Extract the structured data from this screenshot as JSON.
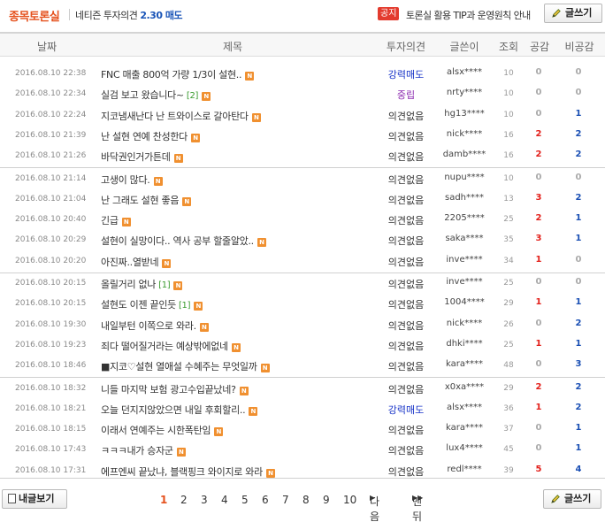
{
  "header": {
    "title_part1": "종목",
    "title_part2": "토론실",
    "stock_name": "네티즌 투자의견",
    "opinion_score": "2.30 매도",
    "notice_badge": "공지",
    "notice_text": "토론실 활용 TIP과 운영원칙 안내",
    "write_label": "글쓰기"
  },
  "columns": [
    "날짜",
    "제목",
    "투자의견",
    "글쓴이",
    "조회",
    "공감",
    "비공감"
  ],
  "rows": [
    {
      "date": "2016.08.10 22:38",
      "title": "FNC 매출 800억 가량 1/3이 설현..",
      "comments": "",
      "opinion": "강력매도",
      "author": "alsx****",
      "views": "10",
      "likes": "0",
      "dislikes": "0"
    },
    {
      "date": "2016.08.10 22:34",
      "title": "실검 보고 왔습니다~",
      "comments": "[2]",
      "opinion": "중립",
      "author": "nrty****",
      "views": "10",
      "likes": "0",
      "dislikes": "0"
    },
    {
      "date": "2016.08.10 22:24",
      "title": "지코냄새난다 난 트와이스로 갈아탄다",
      "comments": "",
      "opinion": "의견없음",
      "author": "hg13****",
      "views": "10",
      "likes": "0",
      "dislikes": "1"
    },
    {
      "date": "2016.08.10 21:39",
      "title": "난 설현 연예 찬성한다",
      "comments": "",
      "opinion": "의견없음",
      "author": "nick****",
      "views": "16",
      "likes": "2",
      "dislikes": "2"
    },
    {
      "date": "2016.08.10 21:26",
      "title": "바닥권인거가튼데",
      "comments": "",
      "opinion": "의견없음",
      "author": "damb****",
      "views": "16",
      "likes": "2",
      "dislikes": "2"
    },
    {
      "date": "2016.08.10 21:14",
      "title": "고생이 많다.",
      "comments": "",
      "opinion": "의견없음",
      "author": "nupu****",
      "views": "10",
      "likes": "0",
      "dislikes": "0"
    },
    {
      "date": "2016.08.10 21:04",
      "title": "난 그래도 설현 좋음",
      "comments": "",
      "opinion": "의견없음",
      "author": "sadh****",
      "views": "13",
      "likes": "3",
      "dislikes": "2"
    },
    {
      "date": "2016.08.10 20:40",
      "title": "긴급",
      "comments": "",
      "opinion": "의견없음",
      "author": "2205****",
      "views": "25",
      "likes": "2",
      "dislikes": "1"
    },
    {
      "date": "2016.08.10 20:29",
      "title": "설현이 실망이다.. 역사 공부 할줄알았..",
      "comments": "",
      "opinion": "의견없음",
      "author": "saka****",
      "views": "35",
      "likes": "3",
      "dislikes": "1"
    },
    {
      "date": "2016.08.10 20:20",
      "title": "아진짜..열받네",
      "comments": "",
      "opinion": "의견없음",
      "author": "inve****",
      "views": "34",
      "likes": "1",
      "dislikes": "0"
    },
    {
      "date": "2016.08.10 20:15",
      "title": "올릴거리 없나",
      "comments": "[1]",
      "opinion": "의견없음",
      "author": "inve****",
      "views": "25",
      "likes": "0",
      "dislikes": "0"
    },
    {
      "date": "2016.08.10 20:15",
      "title": "설현도 이젠 끝인듯",
      "comments": "[1]",
      "opinion": "의견없음",
      "author": "1004****",
      "views": "29",
      "likes": "1",
      "dislikes": "1"
    },
    {
      "date": "2016.08.10 19:30",
      "title": "내일부턴 이쪽으로 와라.",
      "comments": "",
      "opinion": "의견없음",
      "author": "nick****",
      "views": "26",
      "likes": "0",
      "dislikes": "2"
    },
    {
      "date": "2016.08.10 19:23",
      "title": "죄다 떨어질거라는 예상밖에없네",
      "comments": "",
      "opinion": "의견없음",
      "author": "dhki****",
      "views": "25",
      "likes": "1",
      "dislikes": "1"
    },
    {
      "date": "2016.08.10 18:46",
      "title": "■지코♡설현 열애설 수혜주는 무엇일까",
      "comments": "",
      "opinion": "의견없음",
      "author": "kara****",
      "views": "48",
      "likes": "0",
      "dislikes": "3"
    },
    {
      "date": "2016.08.10 18:32",
      "title": "니들 마지막 보험 광고수입끝났네?",
      "comments": "",
      "opinion": "의견없음",
      "author": "x0xa****",
      "views": "29",
      "likes": "2",
      "dislikes": "2"
    },
    {
      "date": "2016.08.10 18:21",
      "title": "오늘 던지지않았으면 내일 후회할리..",
      "comments": "",
      "opinion": "강력매도",
      "author": "alsx****",
      "views": "36",
      "likes": "1",
      "dislikes": "2"
    },
    {
      "date": "2016.08.10 18:15",
      "title": "이래서 연예주는 시한폭탄임",
      "comments": "",
      "opinion": "의견없음",
      "author": "kara****",
      "views": "37",
      "likes": "0",
      "dislikes": "1"
    },
    {
      "date": "2016.08.10 17:43",
      "title": "ㅋㅋㅋ내가 승자군",
      "comments": "",
      "opinion": "의견없음",
      "author": "lux4****",
      "views": "45",
      "likes": "0",
      "dislikes": "1"
    },
    {
      "date": "2016.08.10 17:31",
      "title": "에프엔씨 끝났냐, 블랙핑크 와이지로 와라",
      "comments": "",
      "opinion": "의견없음",
      "author": "redl****",
      "views": "39",
      "likes": "5",
      "dislikes": "4"
    }
  ],
  "footer": {
    "my_posts_label": "내글보기",
    "write_label": "글쓰기",
    "pages": [
      "1",
      "2",
      "3",
      "4",
      "5",
      "6",
      "7",
      "8",
      "9",
      "10"
    ],
    "current_page": "1",
    "next_label": "다음",
    "last_label": "맨뒤"
  },
  "colors": {
    "accent": "#e5511d",
    "buy": "#1a35c8",
    "neutral": "#8c2bb0",
    "like": "#e3201b",
    "dislike": "#1a4fb4",
    "new_badge": "#f09030"
  }
}
